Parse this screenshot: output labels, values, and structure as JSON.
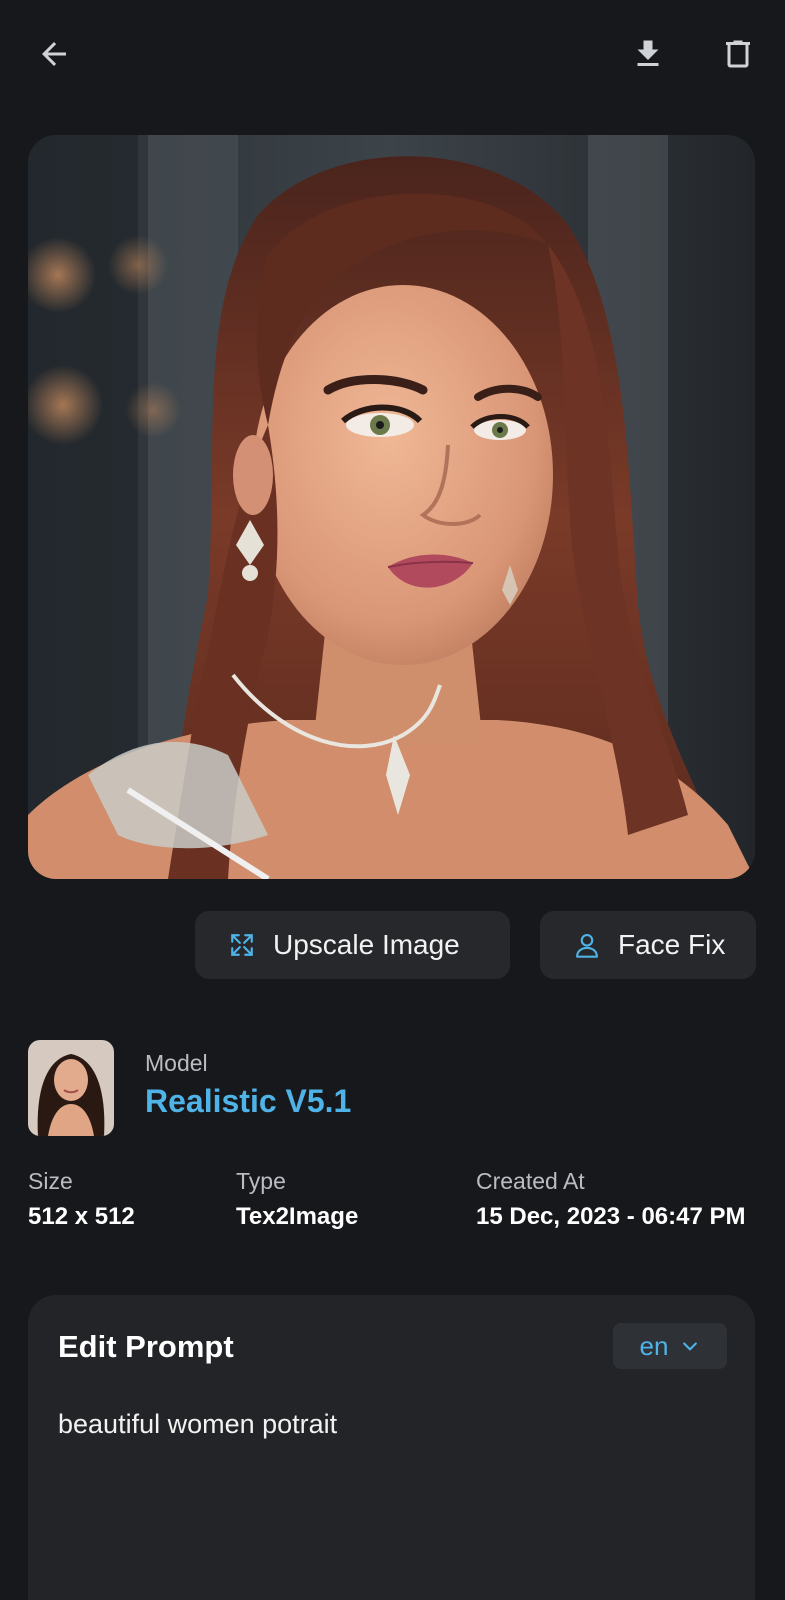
{
  "header": {
    "back_icon": "arrow-left-icon",
    "download_icon": "download-icon",
    "delete_icon": "trash-icon"
  },
  "actions": {
    "upscale_label": "Upscale Image",
    "upscale_icon": "expand-arrows-icon",
    "facefix_label": "Face Fix",
    "facefix_icon": "user-icon"
  },
  "model": {
    "caption": "Model",
    "name": "Realistic V5.1"
  },
  "meta": {
    "size_label": "Size",
    "size_value": "512 x 512",
    "type_label": "Type",
    "type_value": "Tex2Image",
    "created_label": "Created At",
    "created_value": "15 Dec, 2023 - 06:47 PM"
  },
  "prompt": {
    "title": "Edit Prompt",
    "language": "en",
    "text": "beautiful women potrait"
  },
  "colors": {
    "background": "#17181b",
    "card": "#232427",
    "button": "#26282c",
    "accent": "#4fb3e8"
  }
}
